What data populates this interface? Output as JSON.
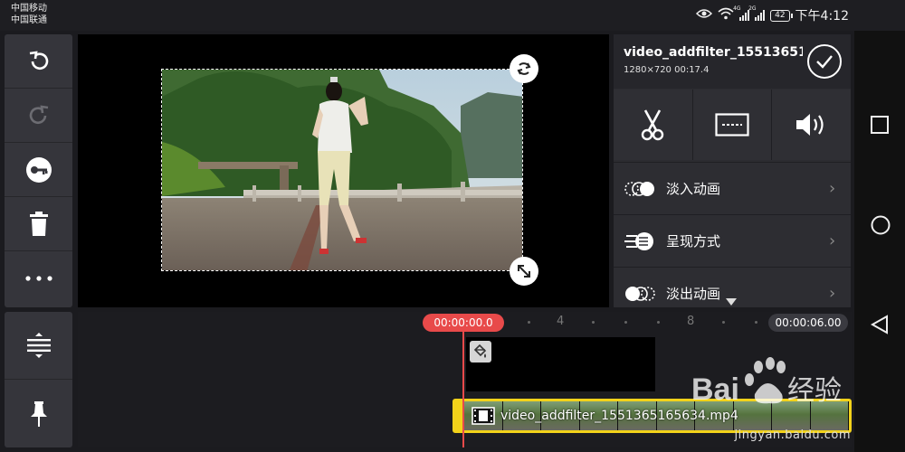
{
  "status_bar": {
    "carrier_1": "中国移动",
    "carrier_2": "中国联通",
    "signal_1_tag": "4G",
    "signal_2_tag": "2G",
    "battery": "42",
    "time": "下午4:12"
  },
  "left_toolbar": {
    "items": [
      "undo-icon",
      "redo-icon",
      "key-icon",
      "trash-icon",
      "more-icon"
    ]
  },
  "clip_panel": {
    "title": "video_addfilter_15513651...",
    "meta": "1280×720  00:17.4"
  },
  "actions": [
    "scissors-icon",
    "subtitle-icon",
    "volume-icon"
  ],
  "effect_rows": [
    {
      "label": "淡入动画"
    },
    {
      "label": "呈现方式"
    },
    {
      "label": "淡出动画"
    }
  ],
  "timeline": {
    "current_time": "00:00:00.0",
    "total_time": "00:00:06.00",
    "ruler_labels": [
      "4",
      "8"
    ],
    "clip_name": "video_addfilter_1551365165634.mp4"
  },
  "bottom_toolbar": [
    "split-icon",
    "pin-icon"
  ],
  "watermark": {
    "text": "Bai  经验",
    "url": "jingyan.baidu.com"
  },
  "colors": {
    "accent_yellow": "#f2d21a",
    "playhead_red": "#e84a4a",
    "panel": "#2c2c31"
  }
}
